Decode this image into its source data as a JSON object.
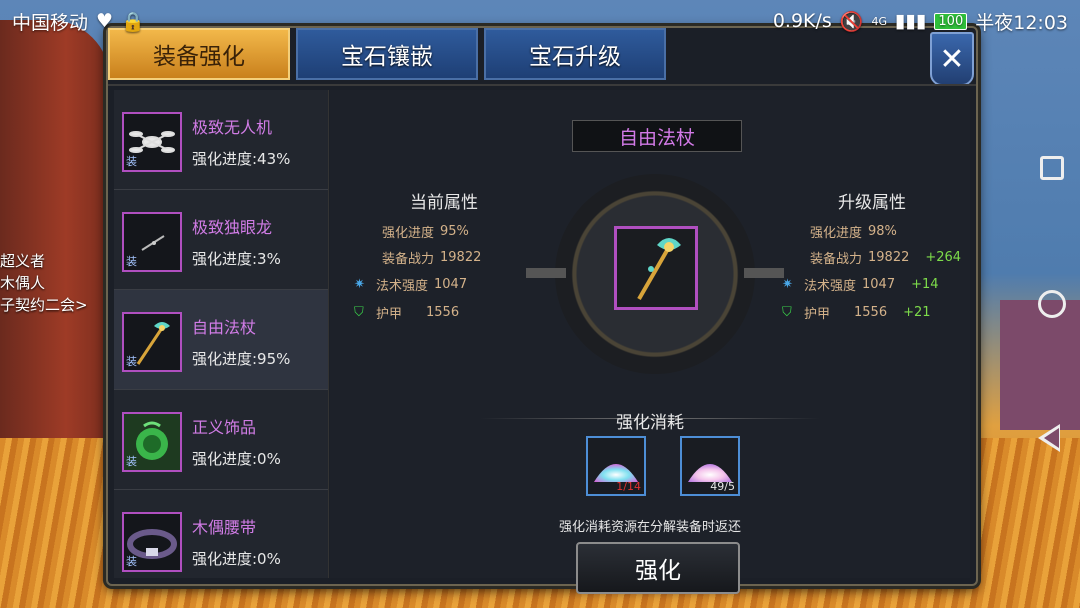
{
  "status_bar": {
    "carrier": "中国移动",
    "speed": "0.9K/s",
    "network": "4G",
    "battery": "100",
    "time": "半夜12:03"
  },
  "background_labels": [
    "超义者",
    "木偶人",
    "子契约二会>"
  ],
  "tabs": [
    {
      "label": "装备强化",
      "active": true
    },
    {
      "label": "宝石镶嵌",
      "active": false
    },
    {
      "label": "宝石升级",
      "active": false
    }
  ],
  "close_label": "✕",
  "items": [
    {
      "name": "极致无人机",
      "progress": "强化进度:43%",
      "tag": "装",
      "icon": "drone-icon"
    },
    {
      "name": "极致独眼龙",
      "progress": "强化进度:3%",
      "tag": "装",
      "icon": "eyepatch-icon"
    },
    {
      "name": "自由法杖",
      "progress": "强化进度:95%",
      "tag": "装",
      "icon": "staff-icon",
      "selected": true
    },
    {
      "name": "正义饰品",
      "progress": "强化进度:0%",
      "tag": "装",
      "icon": "amulet-icon"
    },
    {
      "name": "木偶腰带",
      "progress": "强化进度:0%",
      "tag": "装",
      "icon": "belt-icon"
    }
  ],
  "selected_equip": {
    "title": "自由法杖",
    "current": {
      "heading": "当前属性",
      "progress_label": "强化进度",
      "progress_value": "95%",
      "power_label": "装备战力",
      "power_value": "19822",
      "spell_label": "法术强度",
      "spell_value": "1047",
      "armor_label": "护甲",
      "armor_value": "1556"
    },
    "upgrade": {
      "heading": "升级属性",
      "progress_label": "强化进度",
      "progress_value": "98%",
      "power_label": "装备战力",
      "power_value": "19822",
      "power_plus": "+264",
      "spell_label": "法术强度",
      "spell_value": "1047",
      "spell_plus": "+14",
      "armor_label": "护甲",
      "armor_value": "1556",
      "armor_plus": "+21"
    }
  },
  "consume": {
    "title": "强化消耗",
    "materials": [
      {
        "count": "1/14",
        "count_color": "#e03030",
        "icon": "blue-powder-icon"
      },
      {
        "count": "49/5",
        "count_color": "#e8e8e8",
        "icon": "pink-powder-icon"
      }
    ],
    "note": "强化消耗资源在分解装备时返还",
    "button": "强化"
  }
}
